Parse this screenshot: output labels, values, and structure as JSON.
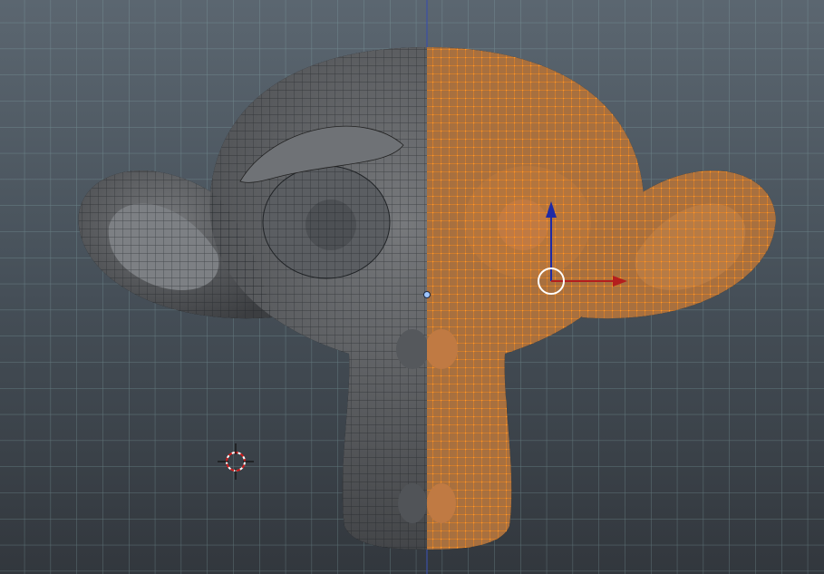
{
  "viewport": {
    "background_top": "#5b6670",
    "background_bottom": "#32373d",
    "grid_color": "#8fb3b6",
    "axis_line_color": "#3b4fa6"
  },
  "mesh": {
    "object": "Suzanne",
    "left_half_color": "#5a5d61",
    "left_wire_color": "#1a1d20",
    "selected_half_color": "#c07a43",
    "selected_wire_color": "#ff8a17"
  },
  "gizmo": {
    "x_axis_color": "#b41e1e",
    "z_axis_color": "#1e2aa6",
    "center_ring_color": "#ffffff"
  },
  "icons": [
    "3d-cursor-icon",
    "transform-gizmo-icon"
  ]
}
